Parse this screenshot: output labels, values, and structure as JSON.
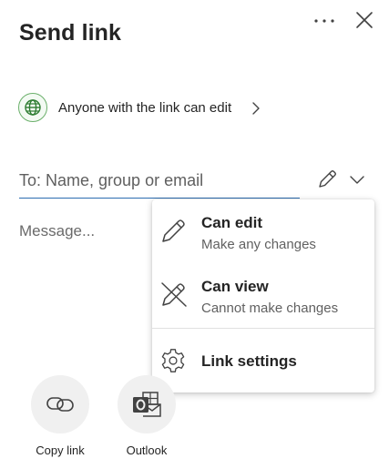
{
  "header": {
    "title": "Send link",
    "more_icon": "more-horizontal-icon",
    "close_icon": "close-icon"
  },
  "link_settings_row": {
    "icon": "globe-icon",
    "text": "Anyone with the link can edit",
    "chevron_icon": "chevron-right-icon"
  },
  "recipients": {
    "placeholder": "To: Name, group or email",
    "value": ""
  },
  "permission_toggle": {
    "icon": "pencil-icon",
    "chevron_icon": "chevron-down-icon",
    "expanded": true
  },
  "message": {
    "placeholder": "Message...",
    "value": ""
  },
  "permission_menu": {
    "items": [
      {
        "icon": "pencil-icon",
        "label": "Can edit",
        "description": "Make any changes"
      },
      {
        "icon": "pencil-off-icon",
        "label": "Can view",
        "description": "Cannot make changes"
      },
      {
        "icon": "gear-icon",
        "label": "Link settings",
        "description": ""
      }
    ]
  },
  "share_targets": [
    {
      "icon": "link-icon",
      "label": "Copy link"
    },
    {
      "icon": "outlook-icon",
      "label": "Outlook"
    }
  ],
  "colors": {
    "accent": "#2b6cb0",
    "globe_green": "#2e7d32",
    "text_primary": "#242424",
    "text_secondary": "#616161",
    "app_circle": "#f0f0f0"
  }
}
